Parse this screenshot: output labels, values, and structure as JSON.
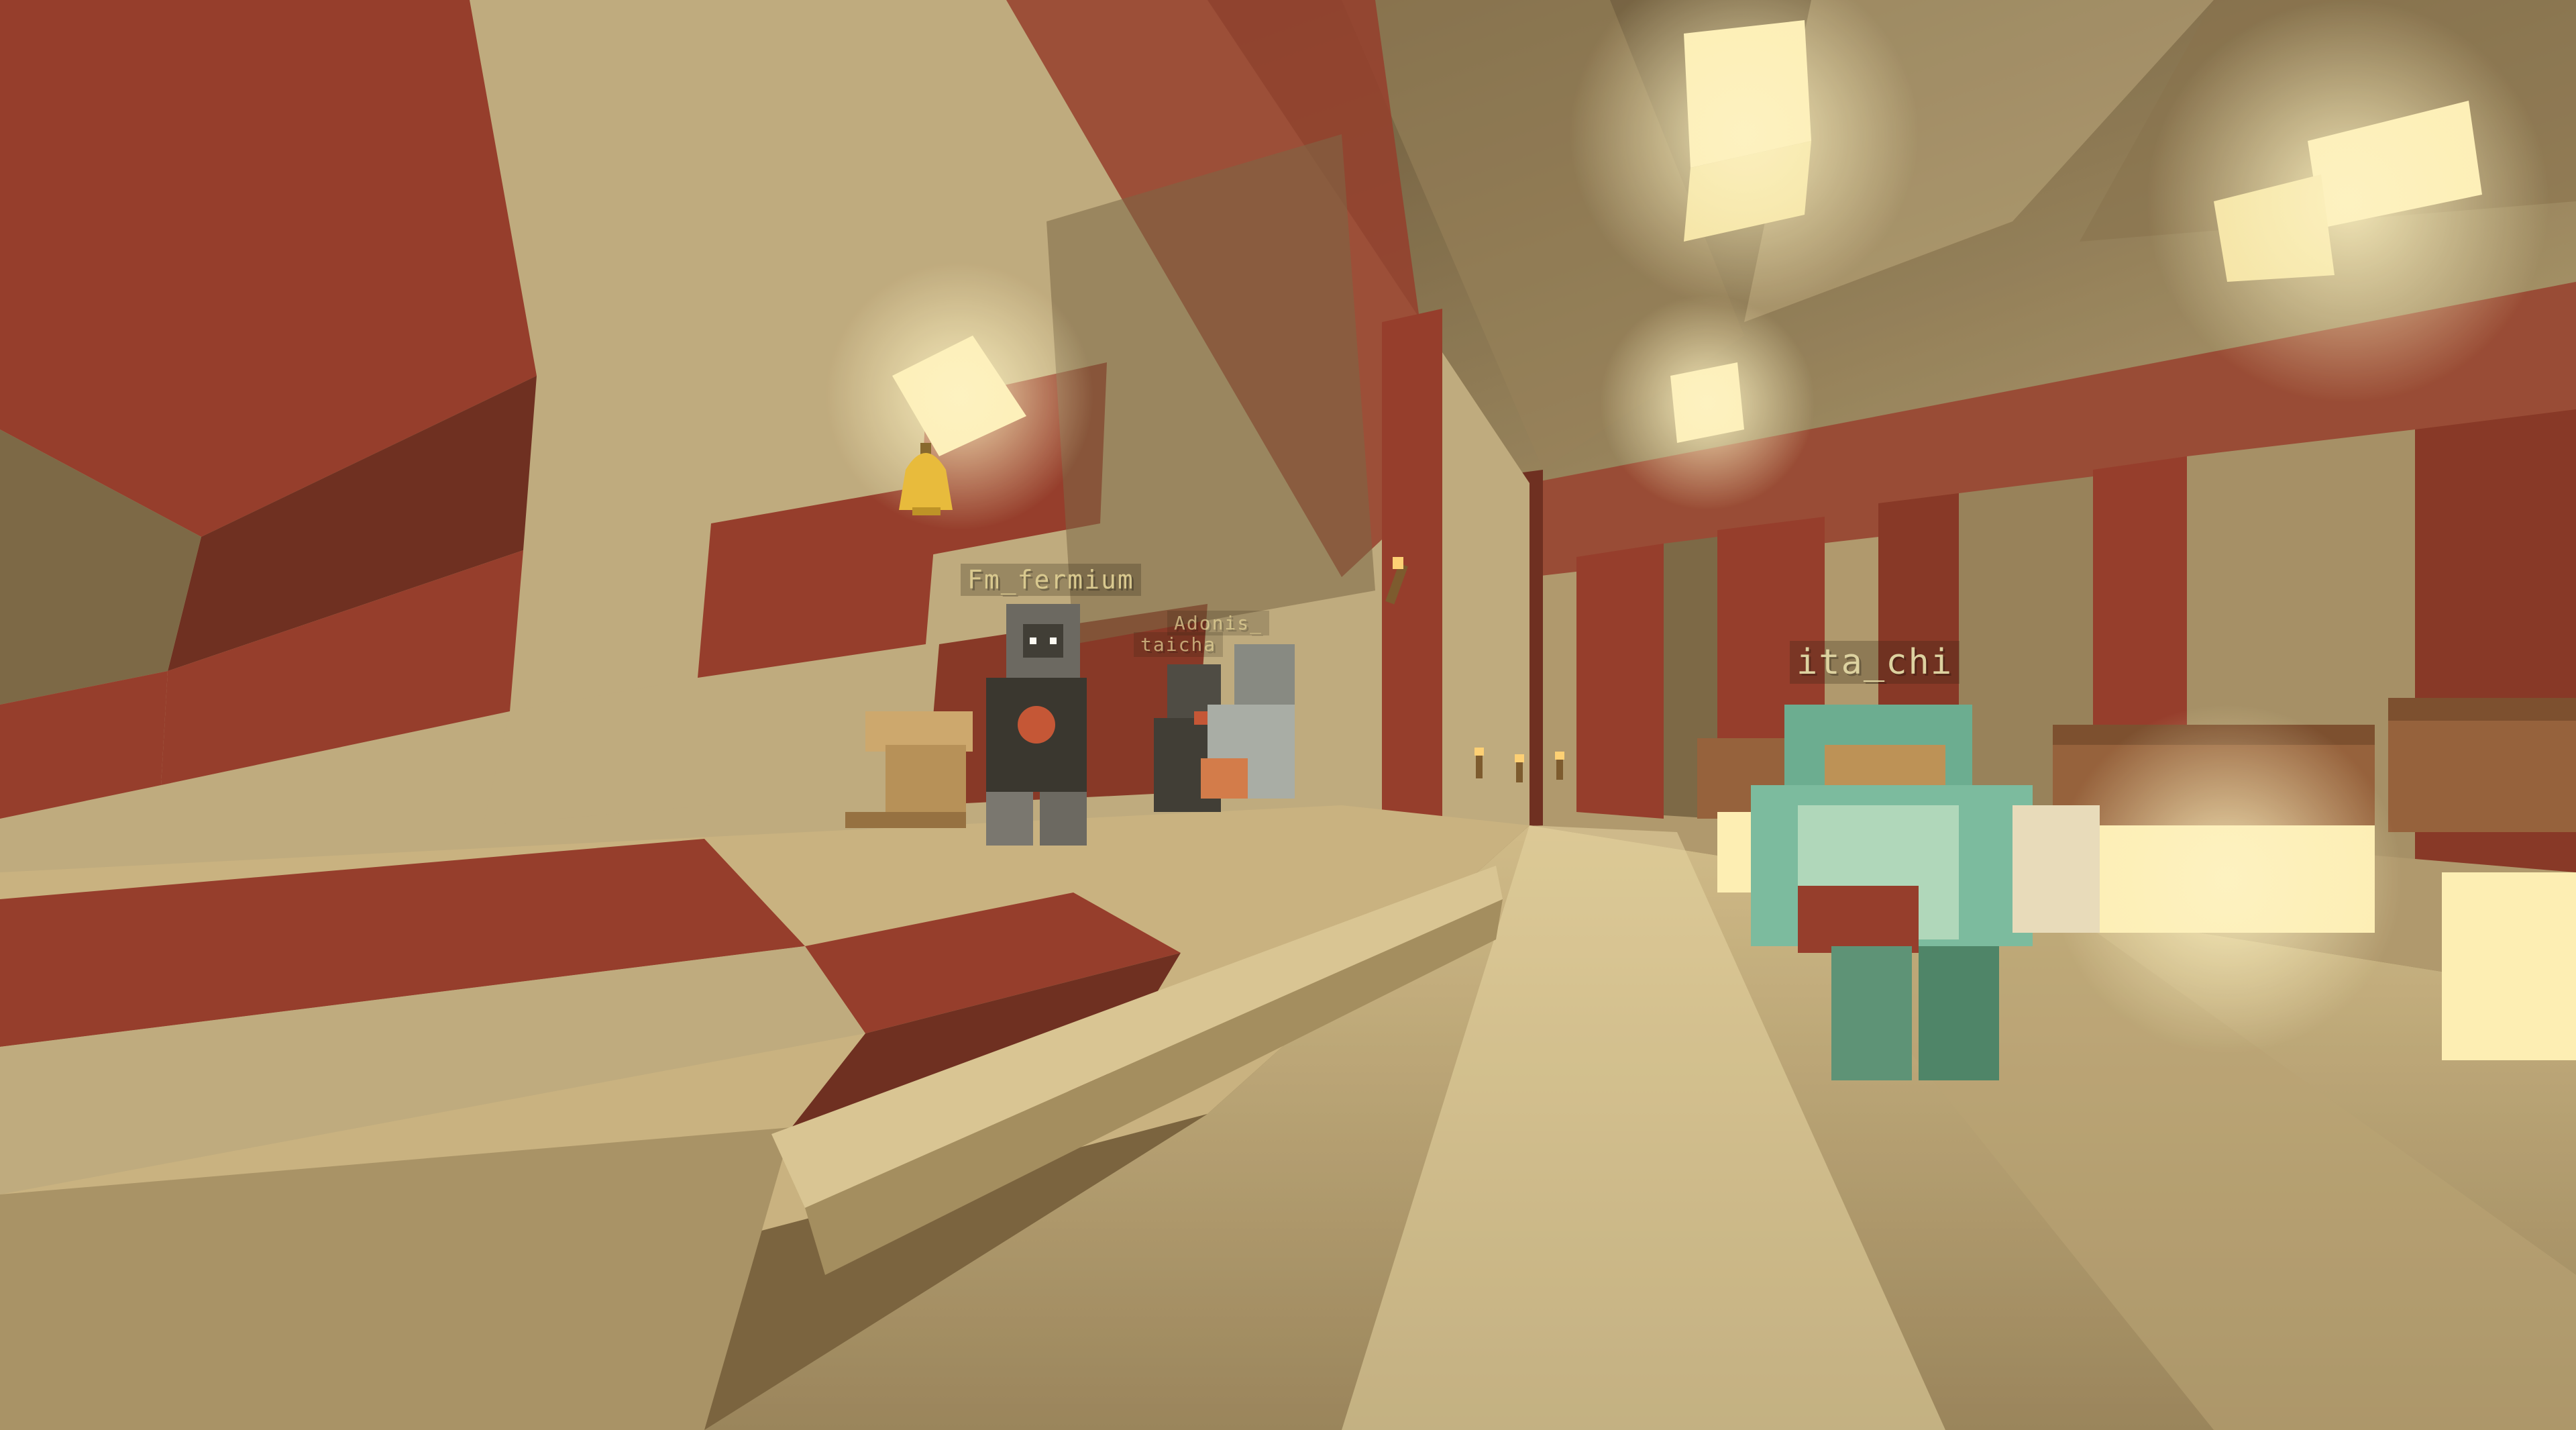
{
  "scene": {
    "type": "minecraft-third-person-view",
    "palette": {
      "red_block": "#8a2a1e",
      "dark_red": "#5e1a12",
      "cream_block": "#b9a57b",
      "shade_block": "#6f5a3c",
      "lamp_glow": "#fff2b8",
      "floor_light": "#d8c48e"
    }
  },
  "players": [
    {
      "name": "Fm_fermium"
    },
    {
      "name": "Adonis_"
    },
    {
      "name": "taicha"
    },
    {
      "name": "ita_chi"
    }
  ],
  "objects": {
    "bell": "bell-icon",
    "torches": "torch-icon",
    "lamps": "glowstone-lamp",
    "barrels": "barrel-block"
  }
}
